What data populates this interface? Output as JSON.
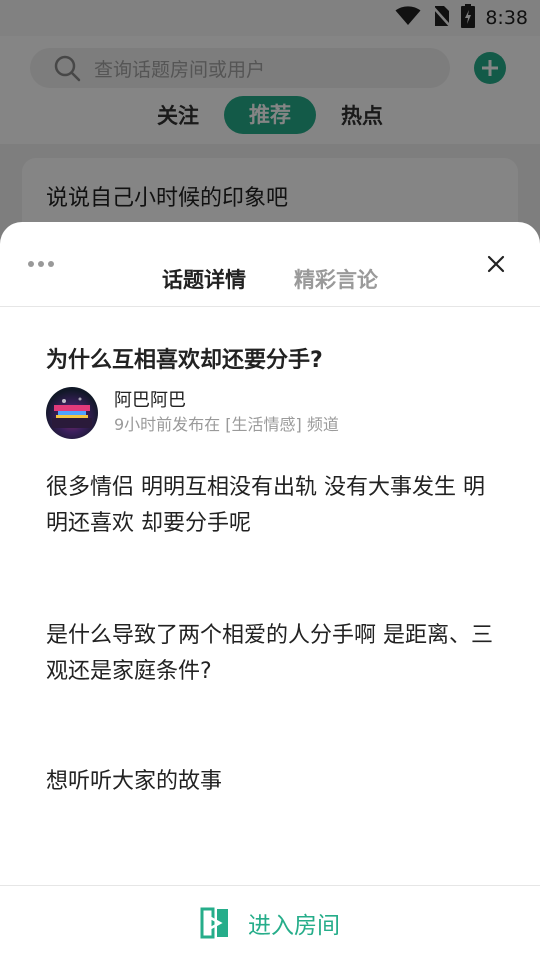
{
  "status_bar": {
    "time": "8:38"
  },
  "search": {
    "placeholder": "查询话题房间或用户"
  },
  "tabs": [
    {
      "label": "关注",
      "active": false
    },
    {
      "label": "推荐",
      "active": true
    },
    {
      "label": "热点",
      "active": false
    }
  ],
  "feed": {
    "card_title": "说说自己小时候的印象吧"
  },
  "sheet": {
    "tabs": [
      {
        "label": "话题详情",
        "active": true
      },
      {
        "label": "精彩言论",
        "active": false
      }
    ],
    "topic": {
      "title": "为什么互相喜欢却还要分手?",
      "author": {
        "name": "阿巴阿巴",
        "meta": "9小时前发布在 [生活情感] 频道"
      },
      "paragraphs": [
        "很多情侣 明明互相没有出轨 没有大事发生 明明还喜欢 却要分手呢",
        "是什么导致了两个相爱的人分手啊 是距离、三观还是家庭条件?",
        "想听听大家的故事"
      ]
    },
    "enter_button": {
      "label": "进入房间"
    }
  },
  "colors": {
    "accent": "#26ad8a"
  }
}
